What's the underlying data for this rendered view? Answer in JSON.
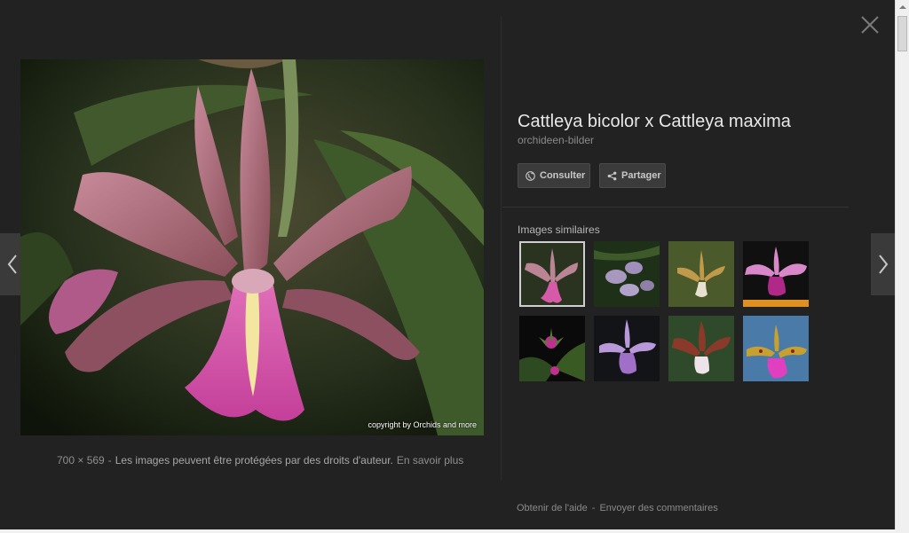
{
  "image": {
    "copyright": "copyright by Orchids and more",
    "dimensions": "700 × 569",
    "separator": "-",
    "rights_notice": "Les images peuvent être protégées par des droits d'auteur.",
    "learn_more": "En savoir plus"
  },
  "details": {
    "title": "Cattleya bicolor x Cattleya maxima",
    "source": "orchideen-bilder",
    "visit_label": "Consulter",
    "share_label": "Partager"
  },
  "similar": {
    "label": "Images similaires",
    "thumbnails": [
      {
        "selected": true
      },
      {
        "selected": false
      },
      {
        "selected": false
      },
      {
        "selected": false
      },
      {
        "selected": false
      },
      {
        "selected": false
      },
      {
        "selected": false
      },
      {
        "selected": false
      }
    ]
  },
  "footer": {
    "help": "Obtenir de l'aide",
    "separator": "-",
    "feedback": "Envoyer des commentaires"
  },
  "icons": {
    "close": "close-icon",
    "prev": "chevron-left-icon",
    "next": "chevron-right-icon",
    "visit": "globe-icon",
    "share": "share-icon"
  },
  "colors": {
    "background": "#222222",
    "button": "#3b3b3b",
    "nav_arrow_bg": "#3a3a3a"
  }
}
